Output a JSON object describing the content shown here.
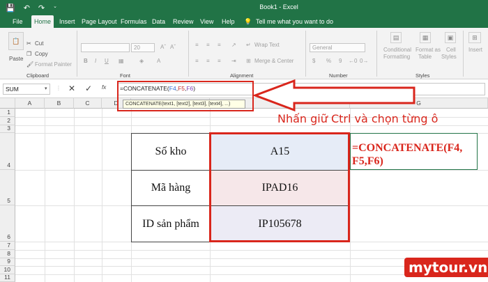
{
  "titlebar": {
    "title": "Book1  -  Excel",
    "save_icon": "save-icon",
    "undo_icon": "undo-icon",
    "redo_icon": "redo-icon"
  },
  "tabs": [
    "File",
    "Home",
    "Insert",
    "Page Layout",
    "Formulas",
    "Data",
    "Review",
    "View",
    "Help"
  ],
  "active_tab": "Home",
  "tell_me": "Tell me what you want to do",
  "ribbon": {
    "clipboard": {
      "paste": "Paste",
      "cut": "Cut",
      "copy": "Copy",
      "format_painter": "Format Painter",
      "label": "Clipboard"
    },
    "font": {
      "size": "20",
      "label": "Font",
      "bold": "B",
      "italic": "I",
      "underline": "U"
    },
    "alignment": {
      "wrap_text": "Wrap Text",
      "merge_center": "Merge & Center",
      "label": "Alignment"
    },
    "number": {
      "format": "General",
      "currency": "$",
      "percent": "%",
      "comma": "9",
      "label": "Number"
    },
    "styles": {
      "conditional": "Conditional",
      "formatting": "Formatting",
      "format_as": "Format as",
      "table": "Table",
      "cell": "Cell",
      "styles_btn": "Styles",
      "label": "Styles"
    },
    "cells": {
      "insert": "Insert"
    }
  },
  "formula_bar": {
    "name_box": "SUM",
    "formula_prefix": "=CONCATENATE(",
    "ref1": "F4",
    "ref2": "F5",
    "ref3": "F6",
    "formula_suffix": ")",
    "tooltip": "CONCATENATE(text1, [text2], [text3], [text4], ...)"
  },
  "columns": [
    "A",
    "B",
    "C",
    "D",
    "E",
    "F",
    "G"
  ],
  "rows": [
    "1",
    "2",
    "3",
    "4",
    "5",
    "6",
    "7",
    "8",
    "9",
    "10",
    "11"
  ],
  "table": [
    {
      "label": "Số kho",
      "value": "A15"
    },
    {
      "label": "Mã hàng",
      "value": "IPAD16"
    },
    {
      "label": "ID sản phẩm",
      "value": "IP105678"
    }
  ],
  "annotation": "Nhấn giữ Ctrl và chọn từng ô",
  "g4_formula": "=CONCATENATE(F4, F5,F6)",
  "watermark": "mytour.vn",
  "colors": {
    "excel_green": "#217346",
    "highlight_red": "#d9261c",
    "row4": "#e6ecf7",
    "row5": "#f6e7e9",
    "row6": "#ecebf5"
  }
}
